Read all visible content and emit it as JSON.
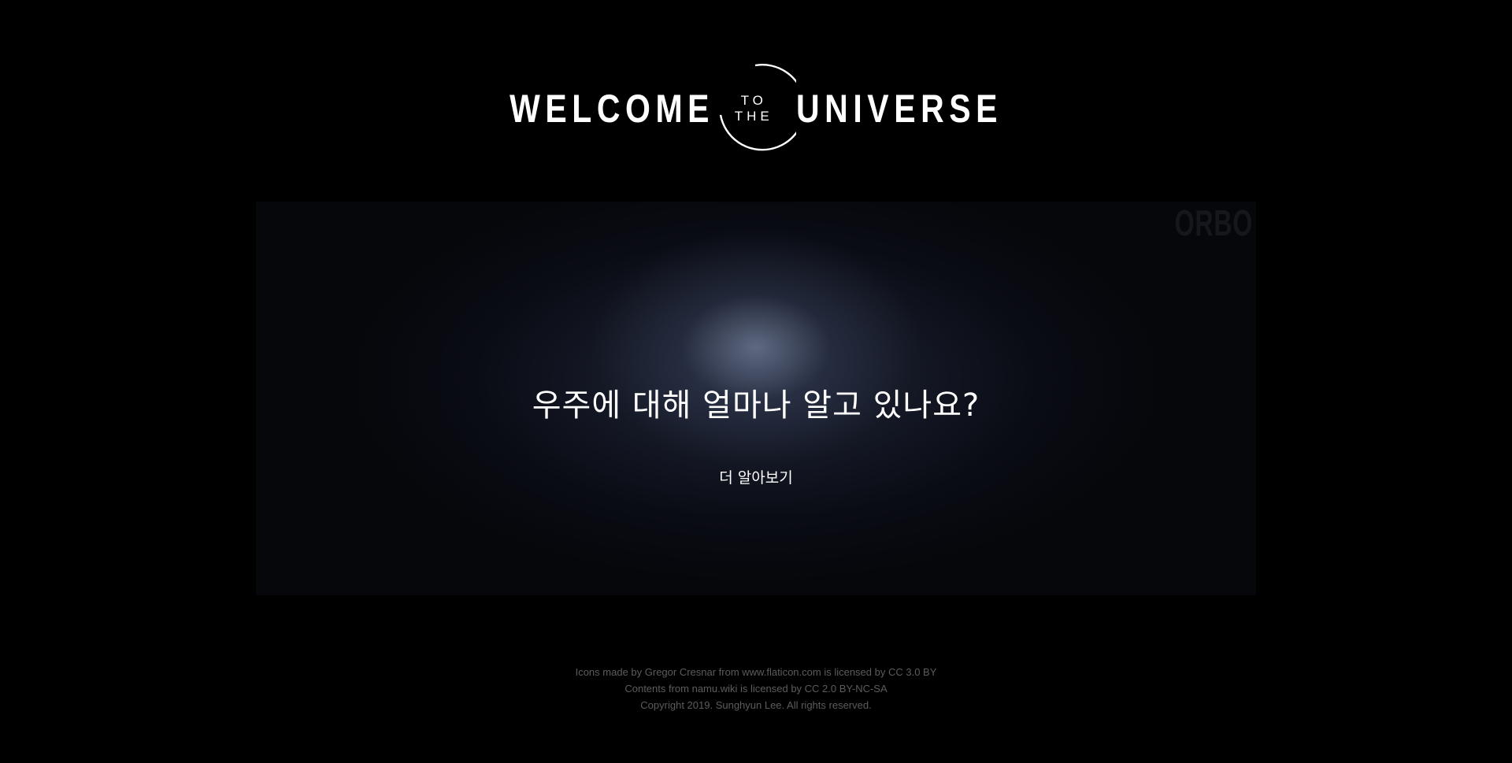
{
  "logo": {
    "word_left": "WELCOME",
    "word_small_top": "TO",
    "word_small_bottom": "THE",
    "word_right": "UNIVERSE"
  },
  "hero": {
    "brand": "ORBO",
    "title": "우주에 대해 얼마나 알고 있나요?",
    "button_label": "더 알아보기"
  },
  "footer": {
    "lines": [
      "Icons made by Gregor Cresnar from www.flaticon.com is licensed by CC 3.0 BY",
      "Contents from namu.wiki is licensed by CC 2.0 BY-NC-SA",
      "Copyright 2019. Sunghyun Lee. All rights reserved."
    ]
  }
}
